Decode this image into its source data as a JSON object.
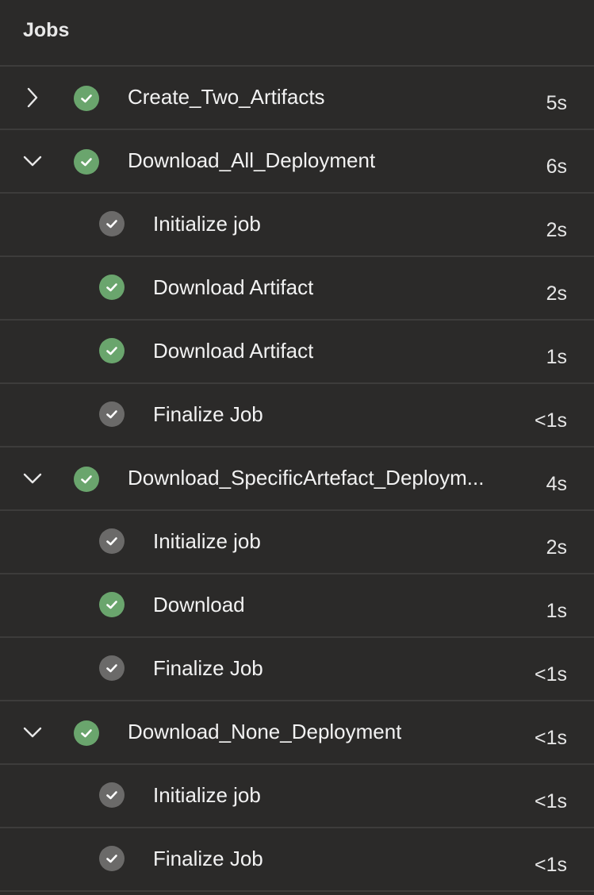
{
  "header": {
    "title": "Jobs"
  },
  "rows": [
    {
      "kind": "job",
      "label": "Create_Two_Artifacts",
      "duration": "5s",
      "status": "success",
      "expanded": false
    },
    {
      "kind": "job",
      "label": "Download_All_Deployment",
      "duration": "6s",
      "status": "success",
      "expanded": true
    },
    {
      "kind": "step",
      "label": "Initialize job",
      "duration": "2s",
      "status": "neutral"
    },
    {
      "kind": "step",
      "label": "Download Artifact",
      "duration": "2s",
      "status": "success"
    },
    {
      "kind": "step",
      "label": "Download Artifact",
      "duration": "1s",
      "status": "success"
    },
    {
      "kind": "step",
      "label": "Finalize Job",
      "duration": "<1s",
      "status": "neutral"
    },
    {
      "kind": "job",
      "label": "Download_SpecificArtefact_Deploym...",
      "duration": "4s",
      "status": "success",
      "expanded": true
    },
    {
      "kind": "step",
      "label": "Initialize job",
      "duration": "2s",
      "status": "neutral"
    },
    {
      "kind": "step",
      "label": "Download",
      "duration": "1s",
      "status": "success"
    },
    {
      "kind": "step",
      "label": "Finalize Job",
      "duration": "<1s",
      "status": "neutral"
    },
    {
      "kind": "job",
      "label": "Download_None_Deployment",
      "duration": "<1s",
      "status": "success",
      "expanded": true
    },
    {
      "kind": "step",
      "label": "Initialize job",
      "duration": "<1s",
      "status": "neutral"
    },
    {
      "kind": "step",
      "label": "Finalize Job",
      "duration": "<1s",
      "status": "neutral"
    }
  ],
  "icons": {
    "collapsed": "chevron-right-icon",
    "expanded": "chevron-down-icon",
    "success": "check-circle-icon",
    "neutral": "check-circle-icon"
  },
  "colors": {
    "background": "#2b2a29",
    "divider": "#3d3c3b",
    "success": "#6aa56d",
    "neutral": "#6b6a69",
    "text": "#f2f2f2"
  }
}
